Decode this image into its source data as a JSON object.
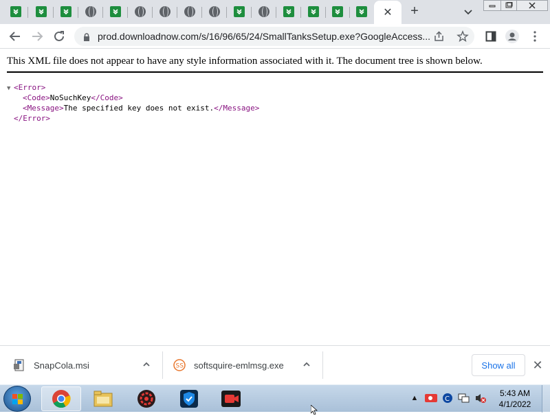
{
  "browser": {
    "tabs": [
      {
        "icon": "green-download-icon"
      },
      {
        "icon": "green-download-icon"
      },
      {
        "icon": "green-download-icon"
      },
      {
        "icon": "globe-icon"
      },
      {
        "icon": "green-download-icon"
      },
      {
        "icon": "globe-icon"
      },
      {
        "icon": "globe-icon"
      },
      {
        "icon": "globe-icon"
      },
      {
        "icon": "globe-icon"
      },
      {
        "icon": "green-download-icon"
      },
      {
        "icon": "globe-icon"
      },
      {
        "icon": "green-download-icon"
      },
      {
        "icon": "green-download-icon"
      },
      {
        "icon": "green-download-icon"
      },
      {
        "icon": "green-download-icon"
      }
    ],
    "active_tab_close": "✕",
    "new_tab": "+",
    "url": "prod.downloadnow.com/s/16/96/65/24/SmallTanksSetup.exe?GoogleAccess..."
  },
  "page": {
    "xml_notice": "This XML file does not appear to have any style information associated with it. The document tree is shown below.",
    "tree": {
      "error_open": "<Error>",
      "code_open": "<Code>",
      "code_value": "NoSuchKey",
      "code_close": "</Code>",
      "message_open": "<Message>",
      "message_value": "The specified key does not exist.",
      "message_close": "</Message>",
      "error_close": "</Error>",
      "triangle": "▼"
    }
  },
  "downloads": {
    "items": [
      {
        "name": "SnapCola.msi"
      },
      {
        "name": "softsquire-emlmsg.exe"
      }
    ],
    "show_all": "Show all",
    "close": "✕"
  },
  "taskbar": {
    "time": "5:43 AM",
    "date": "4/1/2022"
  },
  "colors": {
    "tab_strip": "#dee1e6",
    "xml_tag": "#881280",
    "accent": "#1a73e8"
  }
}
